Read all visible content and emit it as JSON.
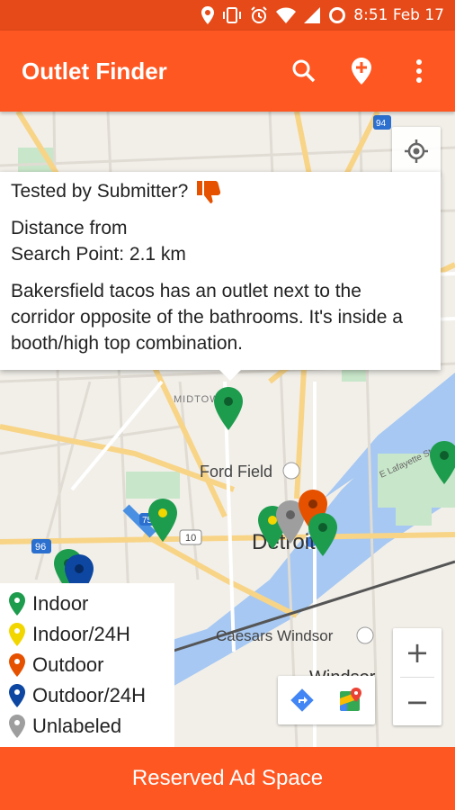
{
  "status_bar": {
    "time_date": "8:51 Feb 17"
  },
  "app_bar": {
    "title": "Outlet Finder"
  },
  "info_window": {
    "tested_label": "Tested by Submitter?",
    "distance_line1": "Distance from",
    "distance_line2": "Search Point: 2.1 km",
    "description": "Bakersfield tacos has an outlet next to the corridor opposite of the bathrooms. It's inside a booth/high top combination."
  },
  "map_labels": {
    "detroit": "Detroit",
    "ford_field": "Ford Field",
    "caesars": "Caesars Windsor",
    "windsor": "Windsor",
    "midtown": "MIDTOWN",
    "lafayette": "E Lafayette St",
    "hwy_10": "10",
    "hwy_75": "75",
    "hwy_96": "96",
    "hwy_94": "94"
  },
  "legend": [
    {
      "label": "Indoor",
      "color": "#1e9c4d"
    },
    {
      "label": "Indoor/24H",
      "color": "#f2d600"
    },
    {
      "label": "Outdoor",
      "color": "#e65100"
    },
    {
      "label": "Outdoor/24H",
      "color": "#0d47a1"
    },
    {
      "label": "Unlabeled",
      "color": "#9e9e9e"
    }
  ],
  "zoom": {
    "in": "+",
    "out": "−"
  },
  "ad_bar": {
    "label": "Reserved Ad Space"
  },
  "colors": {
    "primary": "#ff5722",
    "status": "#e64a19",
    "water": "#4a90e2"
  }
}
